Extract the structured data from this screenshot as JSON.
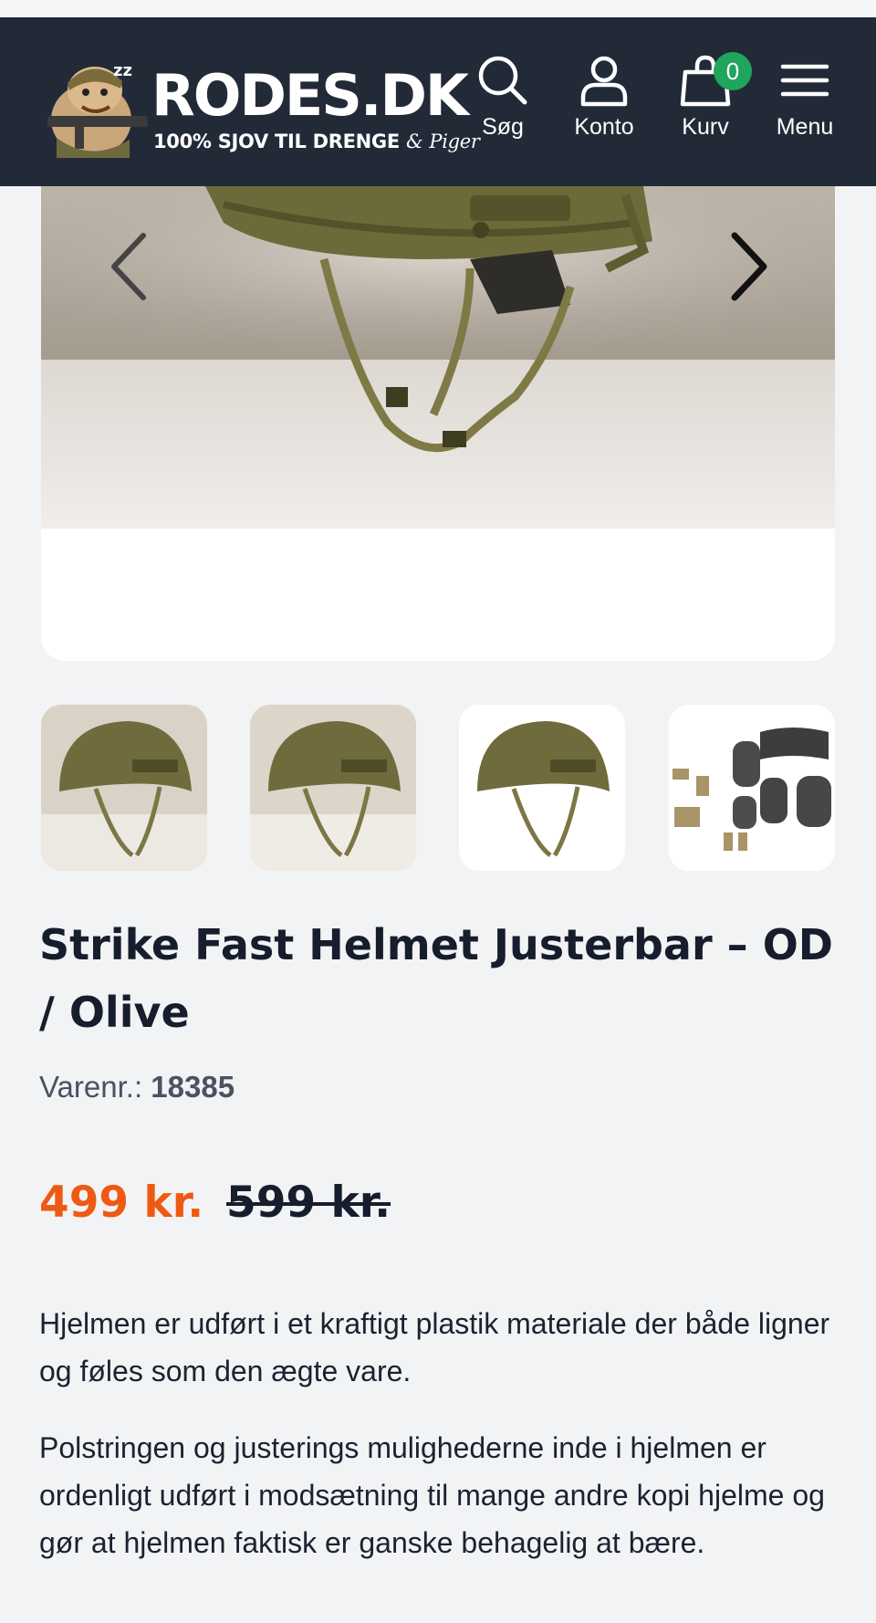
{
  "header": {
    "logo_title": "RODES.DK",
    "logo_tagline_main": "100% SJOV TIL DRENGE",
    "logo_tagline_amp": "&",
    "logo_tagline_script": "Piger",
    "nav": {
      "search_label": "Søg",
      "account_label": "Konto",
      "cart_label": "Kurv",
      "cart_count": "0",
      "menu_label": "Menu"
    }
  },
  "gallery": {
    "main_image": "helmet-photo",
    "thumbnails": [
      "helmet-thumb-1",
      "helmet-thumb-2",
      "helmet-thumb-3",
      "accessories-thumb"
    ]
  },
  "product": {
    "title": "Strike Fast Helmet Justerbar – OD / Olive",
    "sku_label": "Varenr.:",
    "sku_value": "18385",
    "price": "499 kr.",
    "old_price": "599 kr.",
    "description": [
      "Hjelmen er udført i et kraftigt plastik materiale der både ligner og føles som den ægte vare.",
      "Polstringen og justerings mulighederne inde i hjelmen er ordenligt udført i modsætning til mange andre kopi hjelme og gør at hjelmen faktisk er ganske behagelig at bære."
    ]
  },
  "colors": {
    "header_bg": "#222a38",
    "price": "#ee5a13",
    "badge": "#1fa55c",
    "page_bg": "#f2f3f5"
  }
}
